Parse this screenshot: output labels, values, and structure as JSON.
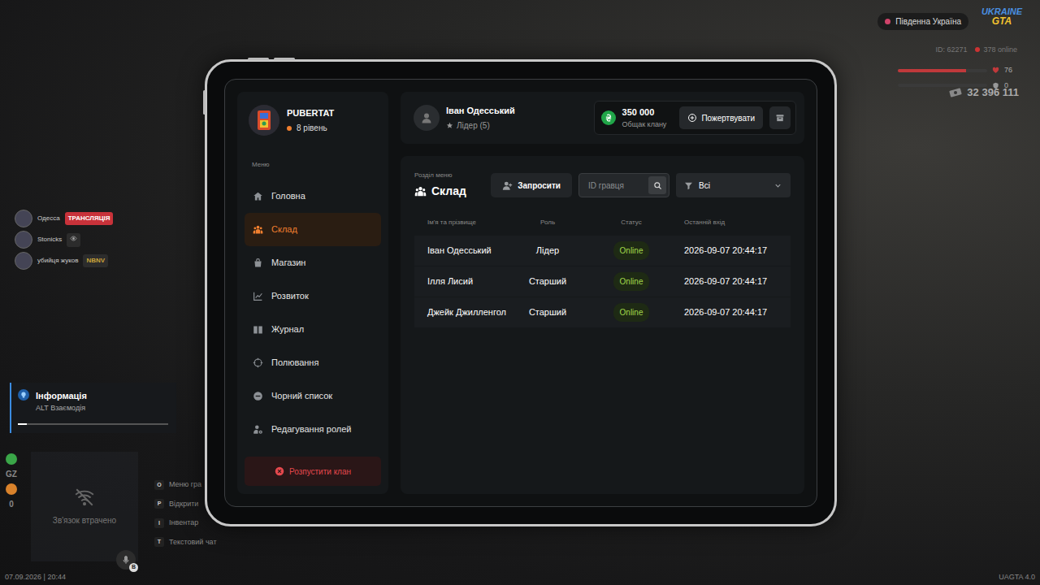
{
  "hud": {
    "region": "Південна Україна",
    "logo": [
      "UKRAINE",
      "GTA"
    ],
    "player_id": "ID: 62271",
    "online": "378 online",
    "health": {
      "reading": "76",
      "level": 0.76
    },
    "armor": {
      "reading": "0",
      "level": 0
    },
    "money": "32 396 111",
    "streamers": [
      {
        "name": "Одесса",
        "badge": "ТРАНСЛЯЦІЯ",
        "kind": "live"
      },
      {
        "name": "Stonicks",
        "kind": "viewer"
      },
      {
        "name": "убийця жуков",
        "badge": "NBNV",
        "kind": "tag"
      }
    ],
    "notification": {
      "title": "Інформація",
      "text": "ALT Взаємодія",
      "level": 0.06
    },
    "stats": [
      {
        "label": "GZ",
        "color": "#3aa648"
      },
      {
        "label": "0",
        "color": "#d9822b"
      }
    ],
    "connection": "Зв'язок втрачено",
    "mic_key": "B",
    "hints": [
      {
        "key": "O",
        "label": "Меню гра"
      },
      {
        "key": "P",
        "label": "Відкрити"
      },
      {
        "key": "I",
        "label": "Інвентар"
      },
      {
        "key": "T",
        "label": "Текстовий чат"
      }
    ],
    "datetime": "07.09.2026 | 20:44",
    "version": "UAGTA 4.0"
  },
  "tablet": {
    "clan": {
      "name": "PUBERTAT",
      "level": "8 рівень"
    },
    "menu_label": "Меню",
    "menu": [
      {
        "label": "Головна",
        "selected": false
      },
      {
        "label": "Склад",
        "selected": true
      },
      {
        "label": "Магазин",
        "selected": false
      },
      {
        "label": "Розвиток",
        "selected": false
      },
      {
        "label": "Журнал",
        "selected": false
      },
      {
        "label": "Полювання",
        "selected": false
      },
      {
        "label": "Чорний список",
        "selected": false
      },
      {
        "label": "Редагування ролей",
        "selected": false
      }
    ],
    "disband": "Розпустити клан",
    "user": {
      "name": "Іван Одесський",
      "rank": "Лідер (5)"
    },
    "treasury": {
      "amount": "350 000",
      "label": "Общак клану"
    },
    "donate": "Пожертвувати",
    "section": {
      "caption": "Розділ меню",
      "title": "Склад"
    },
    "invite": "Запросити",
    "search": {
      "placeholder": "ID гравця"
    },
    "filter": "Всі",
    "table": {
      "columns": [
        "Ім'я та прізвище",
        "Роль",
        "Статус",
        "Останній вхід"
      ],
      "rows": [
        [
          "Іван Одесський",
          "Лідер",
          "Online",
          "2026-09-07 20:44:17"
        ],
        [
          "Ілля Лисий",
          "Старший",
          "Online",
          "2026-09-07 20:44:17"
        ],
        [
          "Джейк Джилленгол",
          "Старший",
          "Online",
          "2026-09-07 20:44:17"
        ]
      ]
    }
  }
}
